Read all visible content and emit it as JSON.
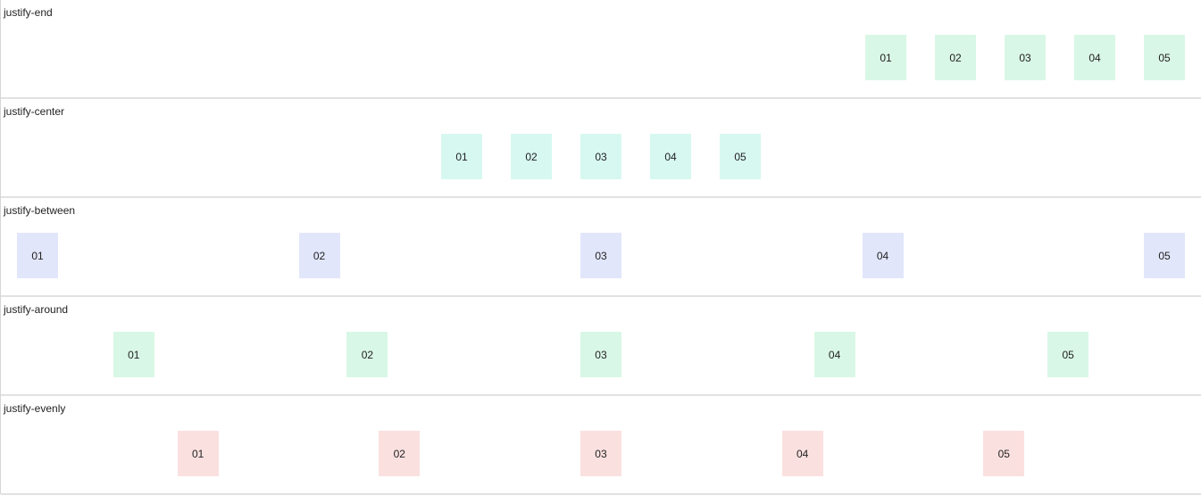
{
  "sections": [
    {
      "title": "justify-end",
      "mode": "justify-end",
      "box_color": "#d9f7e6",
      "items": [
        "01",
        "02",
        "03",
        "04",
        "05"
      ]
    },
    {
      "title": "justify-center",
      "mode": "justify-center",
      "box_color": "#d7f8f0",
      "items": [
        "01",
        "02",
        "03",
        "04",
        "05"
      ]
    },
    {
      "title": "justify-between",
      "mode": "justify-between",
      "box_color": "#e2e6fb",
      "items": [
        "01",
        "02",
        "03",
        "04",
        "05"
      ]
    },
    {
      "title": "justify-around",
      "mode": "justify-around",
      "box_color": "#d9f7e6",
      "items": [
        "01",
        "02",
        "03",
        "04",
        "05"
      ]
    },
    {
      "title": "justify-evenly",
      "mode": "justify-evenly",
      "box_color": "#fbe0e0",
      "items": [
        "01",
        "02",
        "03",
        "04",
        "05"
      ]
    }
  ]
}
